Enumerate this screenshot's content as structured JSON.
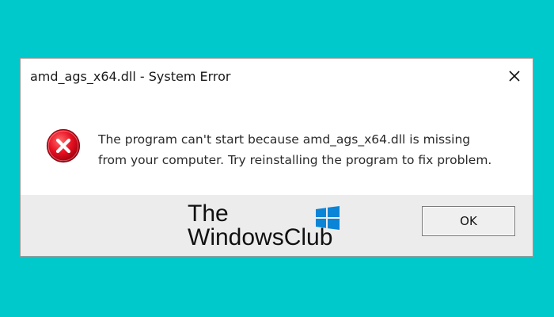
{
  "dialog": {
    "title": "amd_ags_x64.dll - System Error",
    "close_icon": "close-icon",
    "error_icon": "error-icon",
    "message": "The program can't start because amd_ags_x64.dll is missing from your computer. Try reinstalling the program to fix problem.",
    "ok_label": "OK"
  },
  "watermark": {
    "line1": "The",
    "line2": "WindowsClub",
    "logo_icon": "windows-logo-icon"
  },
  "colors": {
    "background": "#00c9cc",
    "error_red": "#e81123",
    "footer": "#ececec",
    "logo_blue": "#0a84d6"
  }
}
